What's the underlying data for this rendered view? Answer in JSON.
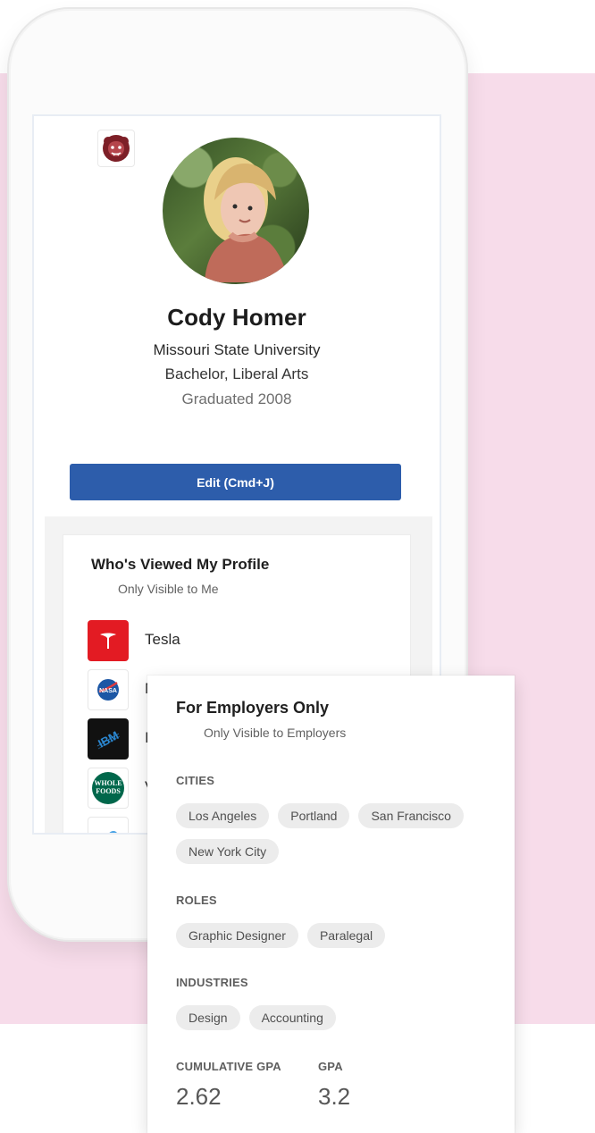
{
  "profile": {
    "name": "Cody Homer",
    "school": "Missouri State University",
    "degree": "Bachelor, Liberal Arts",
    "graduation": "Graduated 2008",
    "edit_button": "Edit (Cmd+J)"
  },
  "viewed": {
    "title": "Who's Viewed My Profile",
    "subtitle": "Only Visible to Me",
    "companies": [
      {
        "name": "Tesla",
        "logo": "tesla-logo"
      },
      {
        "name": "N",
        "logo": "nasa-logo"
      },
      {
        "name": "I",
        "logo": "ibm-logo"
      },
      {
        "name": "V",
        "logo": "whole-foods-logo"
      }
    ]
  },
  "employers": {
    "title": "For Employers Only",
    "subtitle": "Only Visible to Employers",
    "cities_label": "CITIES",
    "cities": [
      "Los Angeles",
      "Portland",
      "San Francisco",
      "New York City"
    ],
    "roles_label": "ROLES",
    "roles": [
      "Graphic Designer",
      "Paralegal"
    ],
    "industries_label": "INDUSTRIES",
    "industries": [
      "Design",
      "Accounting"
    ],
    "cumulative_gpa_label": "CUMULATIVE GPA",
    "cumulative_gpa": "2.62",
    "gpa_label": "GPA",
    "gpa": "3.2"
  },
  "logos": {
    "school_logo": "bear-mascot-logo",
    "whole_foods_text_1": "WHOLE",
    "whole_foods_text_2": "FOODS",
    "nasa_text": "NASA",
    "ibm_text": "IBM"
  },
  "colors": {
    "page_pink": "#f7dcea",
    "primary_blue": "#2d5dab",
    "chip_gray": "#ececec",
    "tesla_red": "#e31b23",
    "ibm_black": "#111111",
    "whole_foods_green": "#00674b"
  }
}
